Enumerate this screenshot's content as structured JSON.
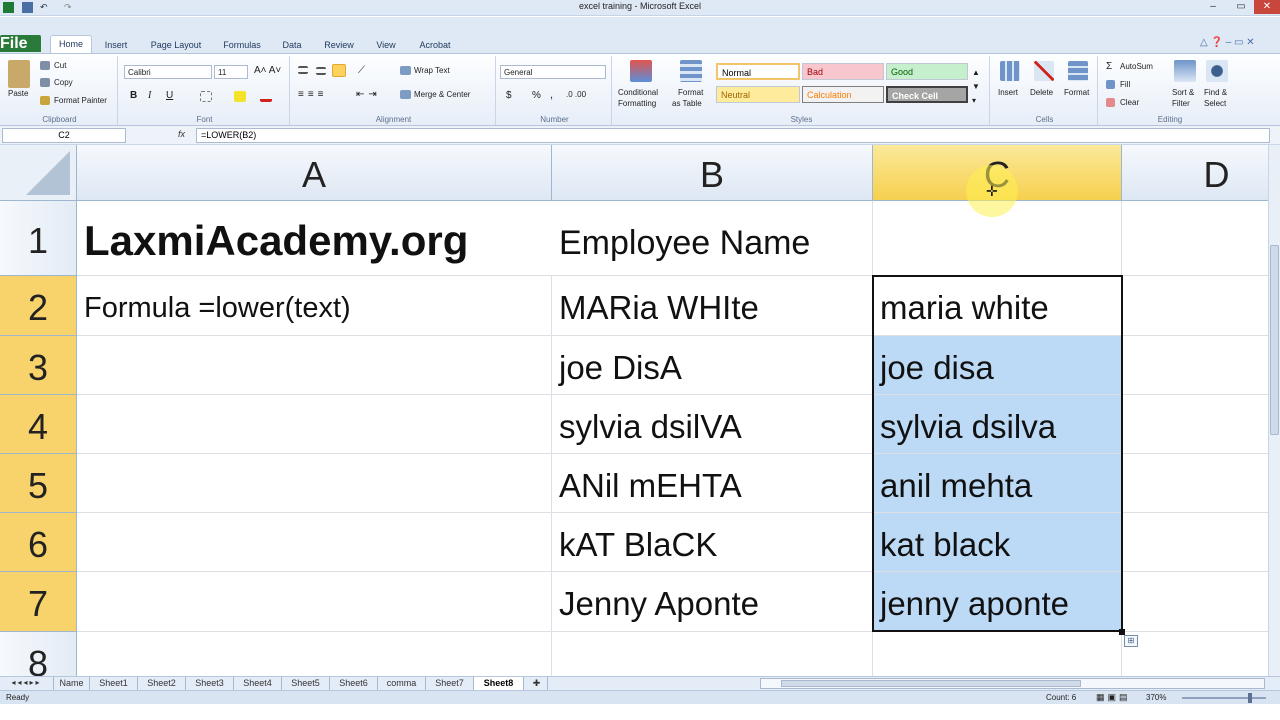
{
  "window": {
    "title": "excel training - Microsoft Excel"
  },
  "tabs": [
    {
      "label": "File"
    },
    {
      "label": "Home"
    },
    {
      "label": "Insert"
    },
    {
      "label": "Page Layout"
    },
    {
      "label": "Formulas"
    },
    {
      "label": "Data"
    },
    {
      "label": "Review"
    },
    {
      "label": "View"
    },
    {
      "label": "Acrobat"
    }
  ],
  "ribbon": {
    "clipboard": {
      "paste": "Paste",
      "cut": "Cut",
      "copy": "Copy",
      "format_painter": "Format Painter",
      "label": "Clipboard"
    },
    "font": {
      "name": "Calibri",
      "size": "11",
      "label": "Font",
      "bold": "B",
      "italic": "I",
      "underline": "U"
    },
    "alignment": {
      "wrap": "Wrap Text",
      "merge": "Merge & Center",
      "label": "Alignment"
    },
    "number": {
      "format": "General",
      "currency": "$",
      "percent": "%",
      "comma": ",",
      "label": "Number"
    },
    "styles": {
      "conditional": "Conditional",
      "conditional2": "Formatting",
      "format_table": "Format",
      "format_table2": "as Table",
      "normal": "Normal",
      "bad": "Bad",
      "good": "Good",
      "neutral": "Neutral",
      "calculation": "Calculation",
      "check_cell": "Check Cell",
      "label": "Styles"
    },
    "cells": {
      "insert": "Insert",
      "delete": "Delete",
      "format": "Format",
      "label": "Cells"
    },
    "editing": {
      "autosum": "AutoSum",
      "fill": "Fill",
      "clear": "Clear",
      "sort": "Sort &",
      "sort2": "Filter",
      "find": "Find &",
      "find2": "Select",
      "label": "Editing"
    }
  },
  "formula_bar": {
    "name_box": "C2",
    "fx": "fx",
    "formula": "=LOWER(B2)"
  },
  "columns": [
    "A",
    "B",
    "C",
    "D"
  ],
  "rows": [
    "1",
    "2",
    "3",
    "4",
    "5",
    "6",
    "7",
    "8"
  ],
  "cells": {
    "A1": "LaxmiAcademy.org",
    "B1": "Employee Name",
    "A2": "Formula =lower(text)",
    "B2": "MARia  WHIte",
    "C2": "maria  white",
    "B3": "joe DisA",
    "C3": "joe disa",
    "B4": "sylvia dsilVA",
    "C4": "sylvia dsilva",
    "B5": "ANil mEHTA",
    "C5": "anil mehta",
    "B6": "kAT  BlaCK",
    "C6": "kat  black",
    "B7": "Jenny Aponte",
    "C7": "jenny aponte"
  },
  "sheets": [
    "Name",
    "Sheet1",
    "Sheet2",
    "Sheet3",
    "Sheet4",
    "Sheet5",
    "Sheet6",
    "comma",
    "Sheet7",
    "Sheet8"
  ],
  "active_sheet": "Sheet8",
  "status": {
    "ready": "Ready",
    "count": "Count: 6",
    "zoom": "370%"
  },
  "colors": {
    "accent": "#2a7a3a",
    "selection": "#bcd9f6",
    "header_selected": "#f8d36b"
  }
}
